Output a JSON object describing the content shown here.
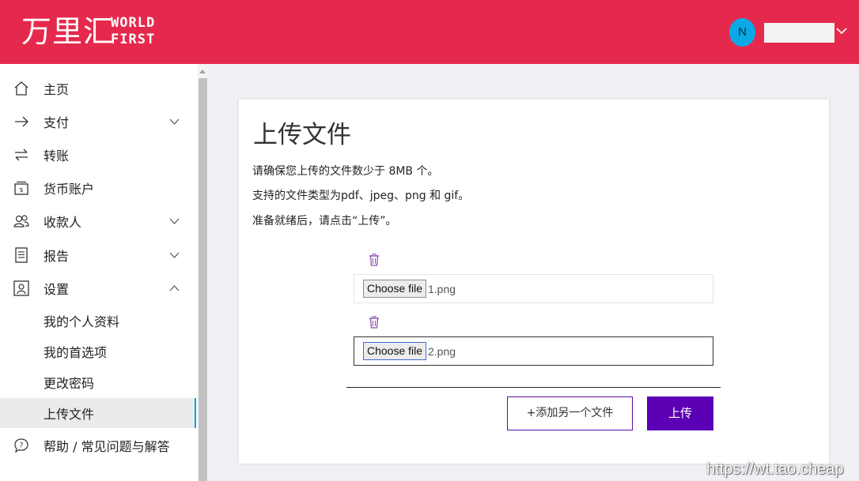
{
  "brand": {
    "name_cn": "万里汇",
    "name_en_line1": "WORLD",
    "name_en_line2": "FIRST",
    "color": "#e5294c"
  },
  "user": {
    "avatar_initial": "N",
    "avatar_color": "#0aa9e6",
    "menu_icon": "chevron-down-icon"
  },
  "sidebar": {
    "items": [
      {
        "label": "主页",
        "icon": "home-icon"
      },
      {
        "label": "支付",
        "icon": "arrow-right-icon",
        "expandable": true
      },
      {
        "label": "转账",
        "icon": "transfer-icon"
      },
      {
        "label": "货币账户",
        "icon": "wallet-icon"
      },
      {
        "label": "收款人",
        "icon": "people-icon",
        "expandable": true
      },
      {
        "label": "报告",
        "icon": "document-icon",
        "expandable": true
      },
      {
        "label": "设置",
        "icon": "settings-profile-icon",
        "expandable": true,
        "expanded": true
      },
      {
        "label": "帮助 / 常见问题与解答",
        "icon": "help-chat-icon"
      }
    ],
    "settings_sub": [
      {
        "label": "我的个人资料"
      },
      {
        "label": "我的首选项"
      },
      {
        "label": "更改密码"
      },
      {
        "label": "上传文件",
        "active": true
      }
    ],
    "active_color": "#00a1e0"
  },
  "main": {
    "title": "上传文件",
    "descriptions": [
      "请确保您上传的文件数少于 8MB 个。",
      "支持的文件类型为pdf、jpeg、png 和 gif。",
      "准备就绪后，请点击“上传”。"
    ],
    "files": [
      {
        "button_label": "Choose file",
        "file_name": "1.png"
      },
      {
        "button_label": "Choose file",
        "file_name": "2.png",
        "focused": true
      }
    ],
    "add_button": "+添加另一个文件",
    "upload_button": "上传",
    "upload_color": "#5b00b5"
  },
  "watermark": "https://wt.tao.cheap"
}
